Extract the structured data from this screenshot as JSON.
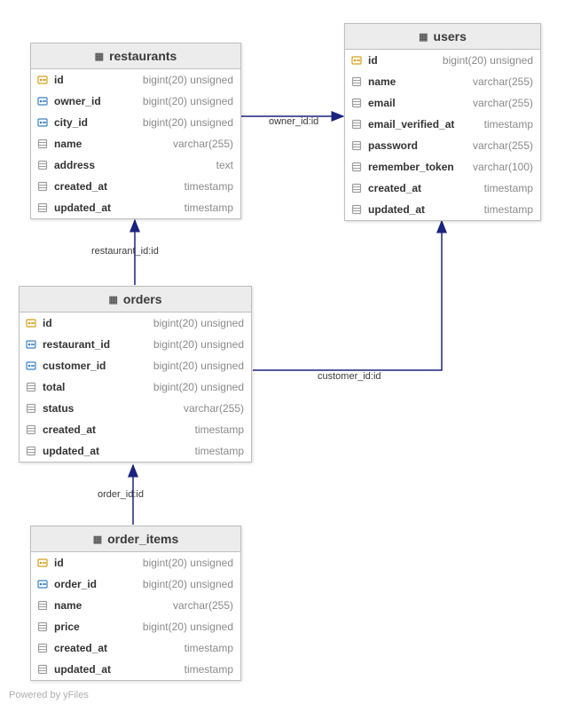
{
  "footer": "Powered by yFiles",
  "tables": {
    "restaurants": {
      "title": "restaurants",
      "columns": [
        {
          "icon": "pk",
          "name": "id",
          "type": "bigint(20) unsigned"
        },
        {
          "icon": "fk",
          "name": "owner_id",
          "type": "bigint(20) unsigned"
        },
        {
          "icon": "fk",
          "name": "city_id",
          "type": "bigint(20) unsigned"
        },
        {
          "icon": "col",
          "name": "name",
          "type": "varchar(255)"
        },
        {
          "icon": "col",
          "name": "address",
          "type": "text"
        },
        {
          "icon": "col",
          "name": "created_at",
          "type": "timestamp"
        },
        {
          "icon": "col",
          "name": "updated_at",
          "type": "timestamp"
        }
      ]
    },
    "users": {
      "title": "users",
      "columns": [
        {
          "icon": "pk",
          "name": "id",
          "type": "bigint(20) unsigned"
        },
        {
          "icon": "col",
          "name": "name",
          "type": "varchar(255)"
        },
        {
          "icon": "col",
          "name": "email",
          "type": "varchar(255)"
        },
        {
          "icon": "col",
          "name": "email_verified_at",
          "type": "timestamp"
        },
        {
          "icon": "col",
          "name": "password",
          "type": "varchar(255)"
        },
        {
          "icon": "col",
          "name": "remember_token",
          "type": "varchar(100)"
        },
        {
          "icon": "col",
          "name": "created_at",
          "type": "timestamp"
        },
        {
          "icon": "col",
          "name": "updated_at",
          "type": "timestamp"
        }
      ]
    },
    "orders": {
      "title": "orders",
      "columns": [
        {
          "icon": "pk",
          "name": "id",
          "type": "bigint(20) unsigned"
        },
        {
          "icon": "fk",
          "name": "restaurant_id",
          "type": "bigint(20) unsigned"
        },
        {
          "icon": "fk",
          "name": "customer_id",
          "type": "bigint(20) unsigned"
        },
        {
          "icon": "col",
          "name": "total",
          "type": "bigint(20) unsigned"
        },
        {
          "icon": "col",
          "name": "status",
          "type": "varchar(255)"
        },
        {
          "icon": "col",
          "name": "created_at",
          "type": "timestamp"
        },
        {
          "icon": "col",
          "name": "updated_at",
          "type": "timestamp"
        }
      ]
    },
    "order_items": {
      "title": "order_items",
      "columns": [
        {
          "icon": "pk",
          "name": "id",
          "type": "bigint(20) unsigned"
        },
        {
          "icon": "fk",
          "name": "order_id",
          "type": "bigint(20) unsigned"
        },
        {
          "icon": "col",
          "name": "name",
          "type": "varchar(255)"
        },
        {
          "icon": "col",
          "name": "price",
          "type": "bigint(20) unsigned"
        },
        {
          "icon": "col",
          "name": "created_at",
          "type": "timestamp"
        },
        {
          "icon": "col",
          "name": "updated_at",
          "type": "timestamp"
        }
      ]
    }
  },
  "edges": {
    "owner_to_users": "owner_id:id",
    "restaurant_to_restaurants": "restaurant_id:id",
    "customer_to_users": "customer_id:id",
    "orderitem_to_orders": "order_id:id"
  },
  "chart_data": {
    "type": "erd",
    "entities": [
      {
        "name": "restaurants",
        "pk": [
          "id"
        ],
        "columns": [
          "id",
          "owner_id",
          "city_id",
          "name",
          "address",
          "created_at",
          "updated_at"
        ]
      },
      {
        "name": "users",
        "pk": [
          "id"
        ],
        "columns": [
          "id",
          "name",
          "email",
          "email_verified_at",
          "password",
          "remember_token",
          "created_at",
          "updated_at"
        ]
      },
      {
        "name": "orders",
        "pk": [
          "id"
        ],
        "columns": [
          "id",
          "restaurant_id",
          "customer_id",
          "total",
          "status",
          "created_at",
          "updated_at"
        ]
      },
      {
        "name": "order_items",
        "pk": [
          "id"
        ],
        "columns": [
          "id",
          "order_id",
          "name",
          "price",
          "created_at",
          "updated_at"
        ]
      }
    ],
    "relations": [
      {
        "from": "restaurants.owner_id",
        "to": "users.id",
        "label": "owner_id:id"
      },
      {
        "from": "orders.restaurant_id",
        "to": "restaurants.id",
        "label": "restaurant_id:id"
      },
      {
        "from": "orders.customer_id",
        "to": "users.id",
        "label": "customer_id:id"
      },
      {
        "from": "order_items.order_id",
        "to": "orders.id",
        "label": "order_id:id"
      }
    ]
  }
}
